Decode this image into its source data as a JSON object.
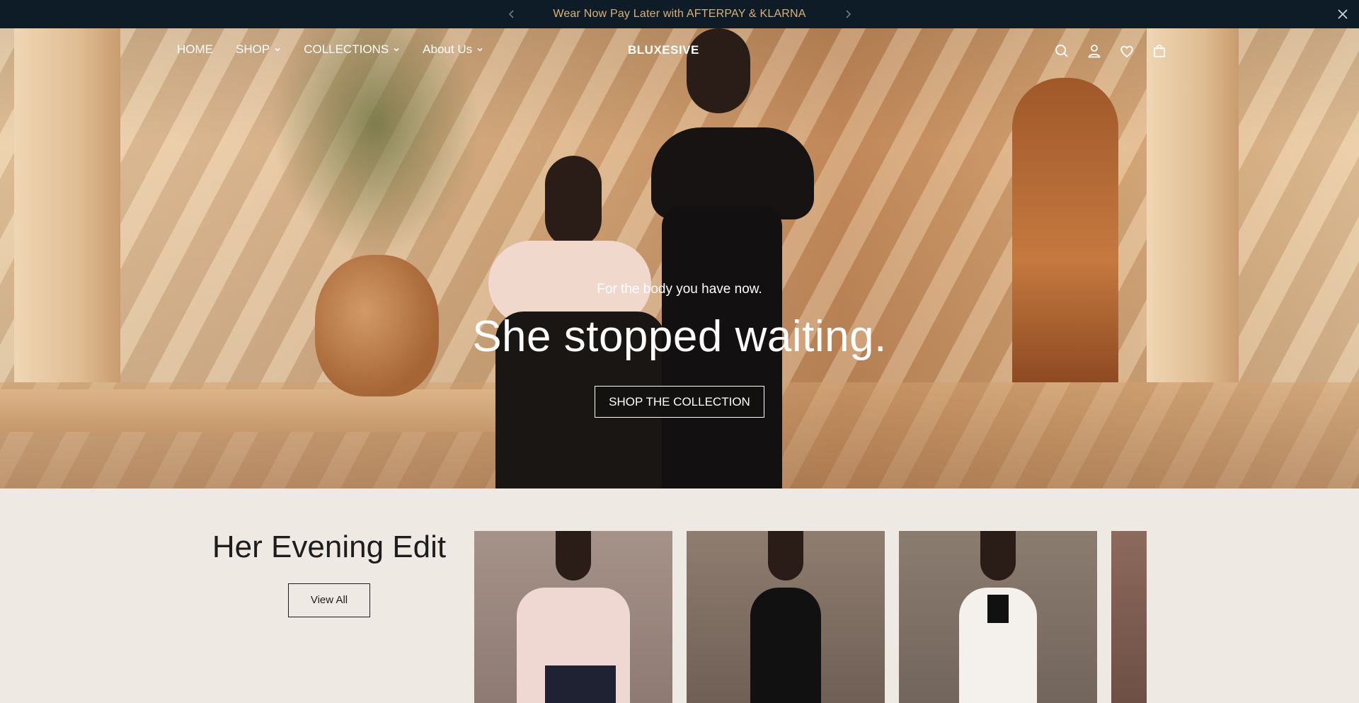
{
  "announcement": {
    "message": "Wear Now Pay Later with AFTERPAY & KLARNA",
    "prev_icon": "chevron-left-icon",
    "next_icon": "chevron-right-icon",
    "close_icon": "close-icon"
  },
  "nav": {
    "menu": [
      {
        "label": "HOME",
        "has_dropdown": false
      },
      {
        "label": "SHOP",
        "has_dropdown": true
      },
      {
        "label": "COLLECTIONS",
        "has_dropdown": true
      },
      {
        "label": "About Us",
        "has_dropdown": true
      }
    ],
    "brand": "BLUXESIVE",
    "icons": [
      "search-icon",
      "account-icon",
      "wishlist-icon",
      "cart-icon"
    ]
  },
  "hero": {
    "kicker": "For the body you have now.",
    "headline": "She stopped waiting.",
    "cta": "SHOP THE COLLECTION"
  },
  "evening_edit": {
    "title": "Her Evening Edit",
    "view_all": "View All",
    "products_visible": 4
  },
  "colors": {
    "announcement_bg": "#0e1c28",
    "announcement_text": "#d7b27a",
    "section_bg": "#efe9e4"
  }
}
